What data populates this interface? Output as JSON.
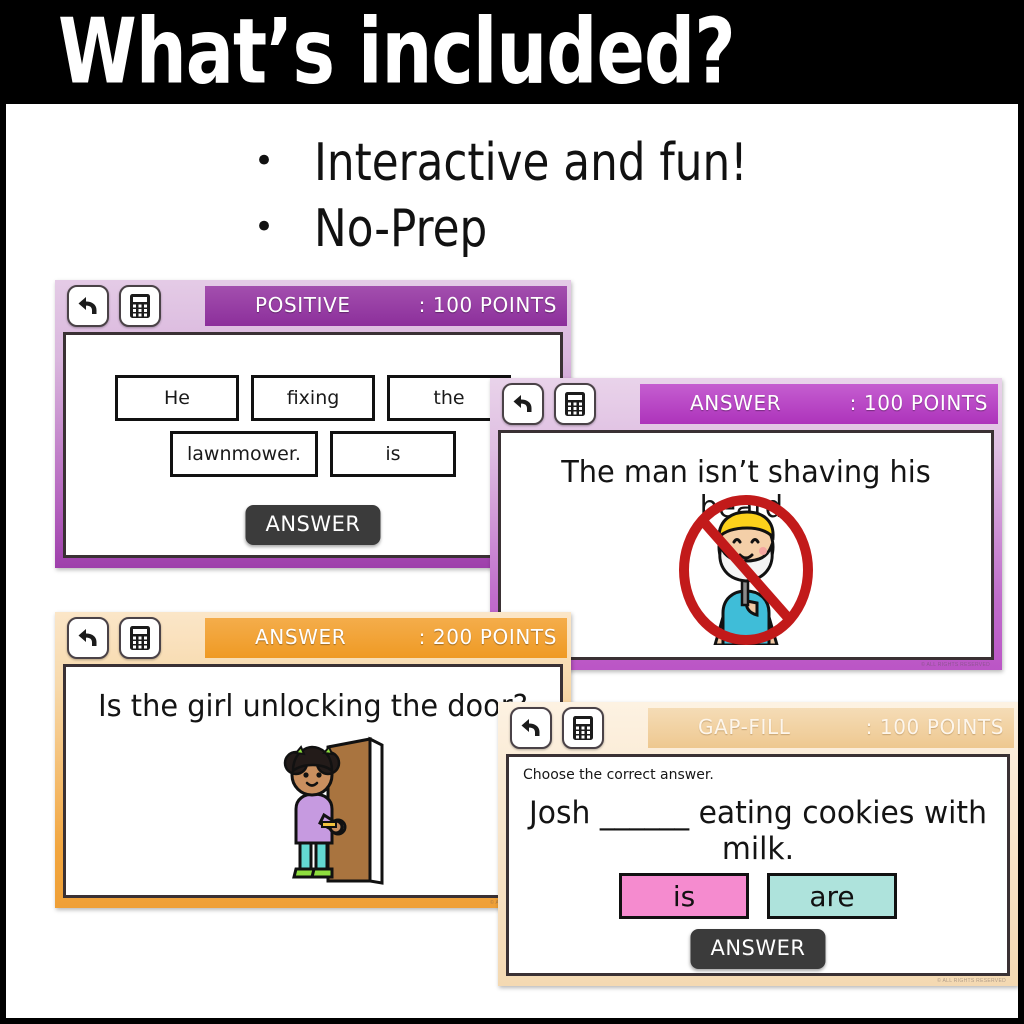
{
  "banner": {
    "title": "What’s included?"
  },
  "bullets": [
    {
      "marker": "•",
      "text": "Interactive and fun!"
    },
    {
      "marker": "•",
      "text": "No-Prep"
    }
  ],
  "icons": {
    "back": "back-arrow-icon",
    "calculator": "calculator-icon"
  },
  "colors": {
    "purple_dark": "#8c2f9b",
    "purple_light": "#e4cbe6",
    "magenta": "#ad33bb",
    "orange": "#ef9a24",
    "orange_faded": "#eec890",
    "answer_button": "#3b3b3b",
    "choice_pink": "#f58bcf",
    "choice_mint": "#aee3dc"
  },
  "cards": [
    {
      "id": "positive",
      "header_label": "POSITIVE",
      "header_points": ": 100 POINTS",
      "answer_button": "ANSWER",
      "word_rows": [
        [
          "He",
          "fixing",
          "the"
        ],
        [
          "lawnmower.",
          "is"
        ]
      ],
      "watermark": "© ALL RIGHTS RESERVED"
    },
    {
      "id": "answer-beard",
      "header_label": "ANSWER",
      "header_points": ": 100 POINTS",
      "sentence": "The man isn’t shaving his beard.",
      "image_alt": "man-not-shaving-beard-illustration",
      "watermark": "© ALL RIGHTS RESERVED"
    },
    {
      "id": "answer-door",
      "header_label": "ANSWER",
      "header_points": ": 200 POINTS",
      "sentence": "Is the girl unlocking the door?",
      "image_alt": "girl-unlocking-door-illustration",
      "watermark": "© ALL RIGHTS RESERVED"
    },
    {
      "id": "gap-fill",
      "header_label": "GAP-FILL",
      "header_points": ": 100 POINTS",
      "hint": "Choose the correct answer.",
      "sentence_line1": "Josh ______ eating cookies with",
      "sentence_line2": "milk.",
      "choices": [
        {
          "label": "is",
          "color": "#f58bcf"
        },
        {
          "label": "are",
          "color": "#aee3dc"
        }
      ],
      "answer_button": "ANSWER",
      "watermark": "© ALL RIGHTS RESERVED"
    }
  ]
}
